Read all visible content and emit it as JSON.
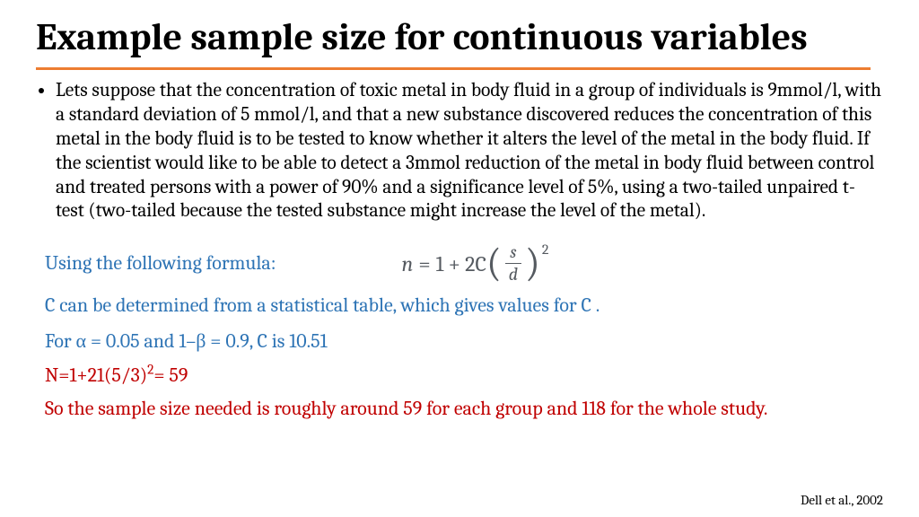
{
  "title": "Example sample size for continuous variables",
  "bullet": "Lets suppose that the concentration of toxic metal in body fluid in a group of individuals is 9mmol/l, with a standard deviation of 5 mmol/l, and that a new substance discovered reduces the concentration of this metal in the body fluid is to be tested to know whether it alters the level of the metal in the body fluid. If the scientist would like to be able to detect a 3mmol reduction of the metal in body fluid between control and treated persons with a power of 90% and a significance level of 5%, using a two-tailed unpaired t-test (two-tailed because the tested substance might increase the level of the metal).",
  "formula_intro": "Using the following formula:",
  "formula": {
    "lhs": "n",
    "eq": "=",
    "rhs_prefix": "1 + 2C",
    "frac_num": "s",
    "frac_den": "d",
    "exp": "2"
  },
  "line_c_desc": "C can be determined from a statistical table, which gives values for C .",
  "line_alpha": "For α = 0.05 and 1–β = 0.9, C is 10.51",
  "line_n_part1": "N=1+21(5/3)",
  "line_n_exp": "2",
  "line_n_part2": "= 59",
  "conclusion": "So the sample size needed is roughly around 59 for each group and 118 for the whole study.",
  "citation": "Dell et al., 2002"
}
